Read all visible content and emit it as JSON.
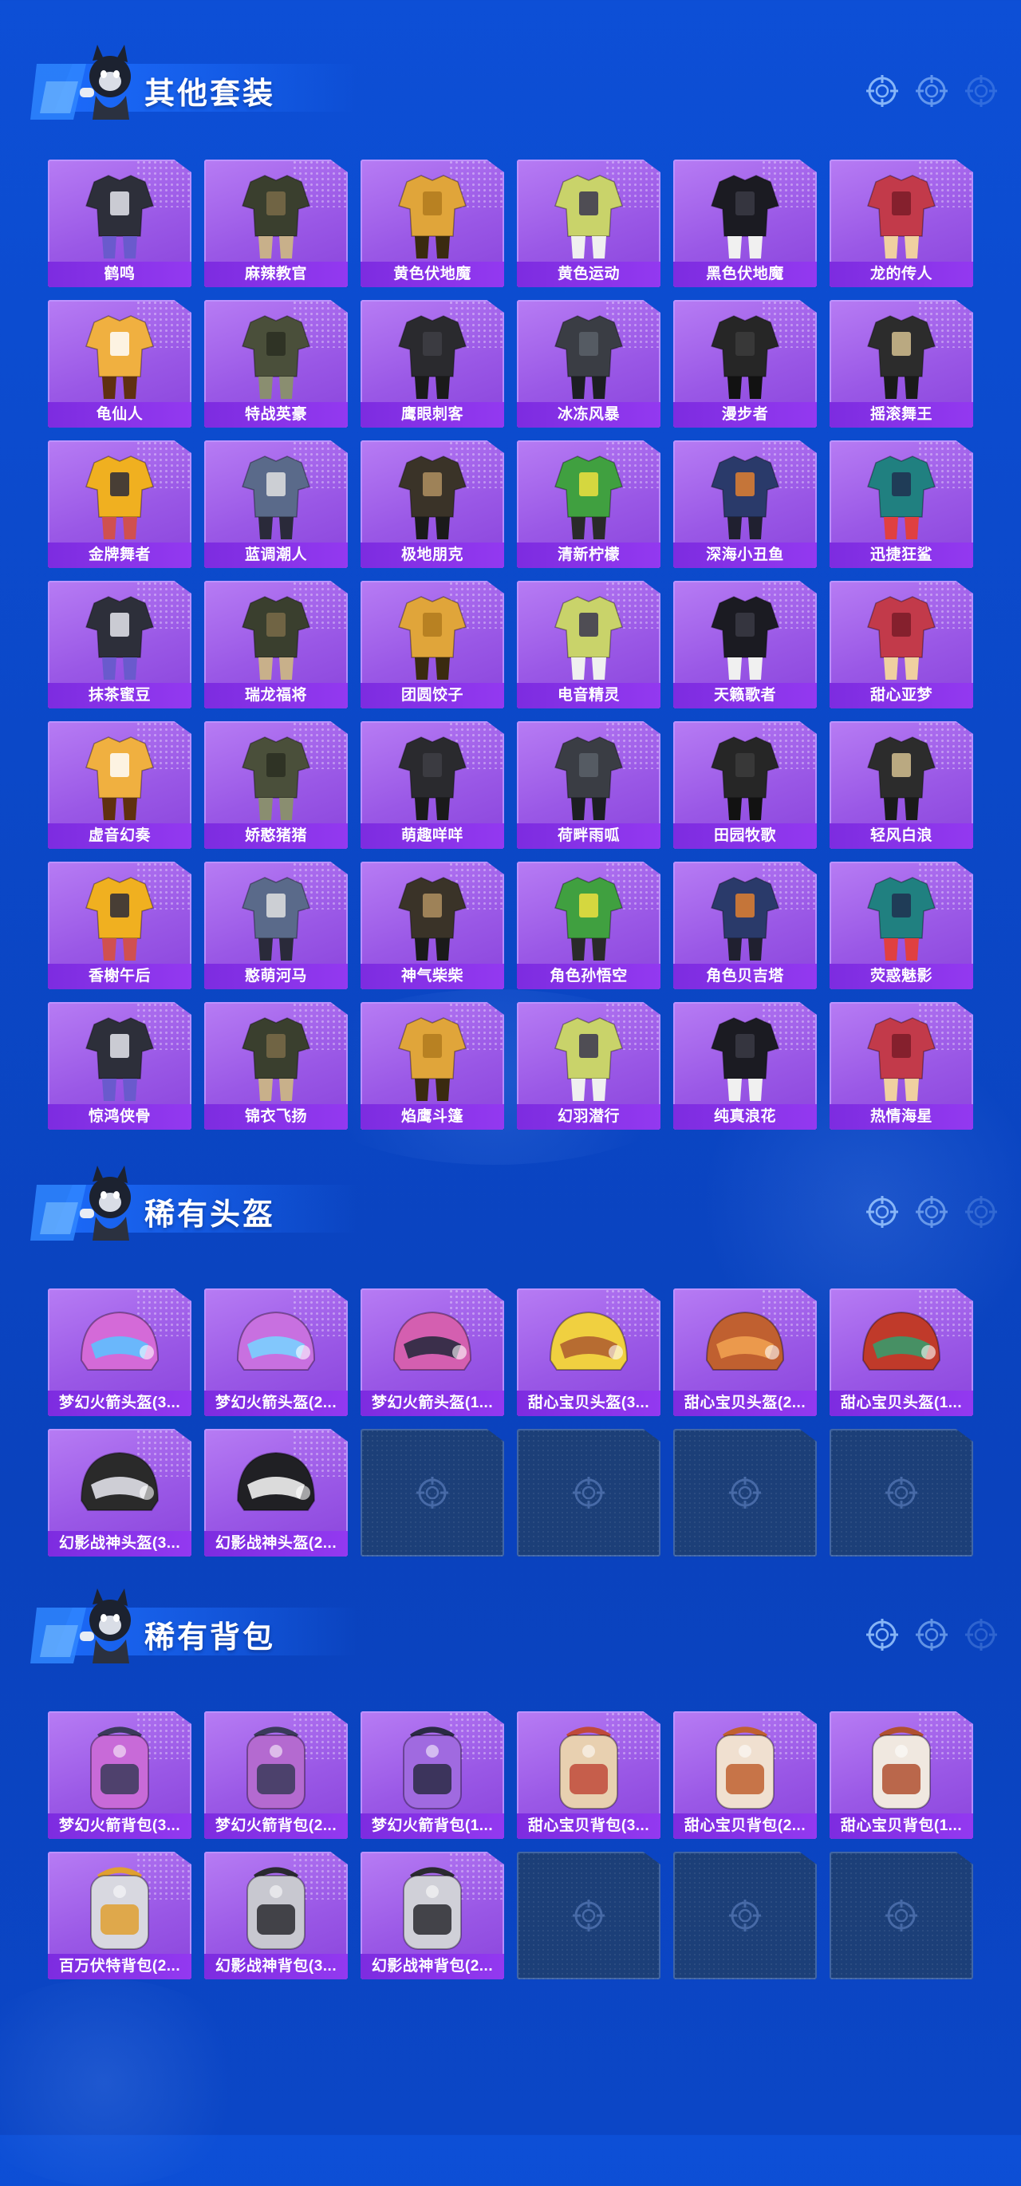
{
  "sections": [
    {
      "title": "其他套装",
      "kind": "outfit",
      "items": [
        "鹤鸣",
        "麻辣教官",
        "黄色伏地魔",
        "黄色运动",
        "黑色伏地魔",
        "龙的传人",
        "龟仙人",
        "特战英豪",
        "鹰眼刺客",
        "冰冻风暴",
        "漫步者",
        "摇滚舞王",
        "金牌舞者",
        "蓝调潮人",
        "极地朋克",
        "清新柠檬",
        "深海小丑鱼",
        "迅捷狂鲨",
        "抹茶蜜豆",
        "瑞龙福将",
        "团圆饺子",
        "电音精灵",
        "天籁歌者",
        "甜心亚梦",
        "虚音幻奏",
        "娇憨猪猪",
        "萌趣咩咩",
        "荷畔雨呱",
        "田园牧歌",
        "轻风白浪",
        "香榭午后",
        "憨萌河马",
        "神气柴柴",
        "角色孙悟空",
        "角色贝吉塔",
        "荧惑魅影",
        "惊鸿侠骨",
        "锦衣飞扬",
        "焰鹰斗篷",
        "幻羽潜行",
        "纯真浪花",
        "热情海星"
      ],
      "empty_slots": 0
    },
    {
      "title": "稀有头盔",
      "kind": "helmet",
      "items": [
        "梦幻火箭头盔(3...",
        "梦幻火箭头盔(2...",
        "梦幻火箭头盔(1...",
        "甜心宝贝头盔(3...",
        "甜心宝贝头盔(2...",
        "甜心宝贝头盔(1...",
        "幻影战神头盔(3...",
        "幻影战神头盔(2..."
      ],
      "empty_slots": 4
    },
    {
      "title": "稀有背包",
      "kind": "backpack",
      "items": [
        "梦幻火箭背包(3...",
        "梦幻火箭背包(2...",
        "梦幻火箭背包(1...",
        "甜心宝贝背包(3...",
        "甜心宝贝背包(2...",
        "甜心宝贝背包(1...",
        "百万伏特背包(2...",
        "幻影战神背包(3...",
        "幻影战神背包(2..."
      ],
      "empty_slots": 3
    }
  ],
  "colors": {
    "background": "#0b48c8",
    "card_purple": "#9a58e6",
    "label_purple": "#8634e8",
    "empty_slot": "#1c3f78"
  },
  "icons": {
    "header": [
      "crosshair-icon",
      "crosshair-icon",
      "crosshair-icon"
    ],
    "empty_slot": "crosshair-icon",
    "mascot": "mascot-character-icon"
  }
}
